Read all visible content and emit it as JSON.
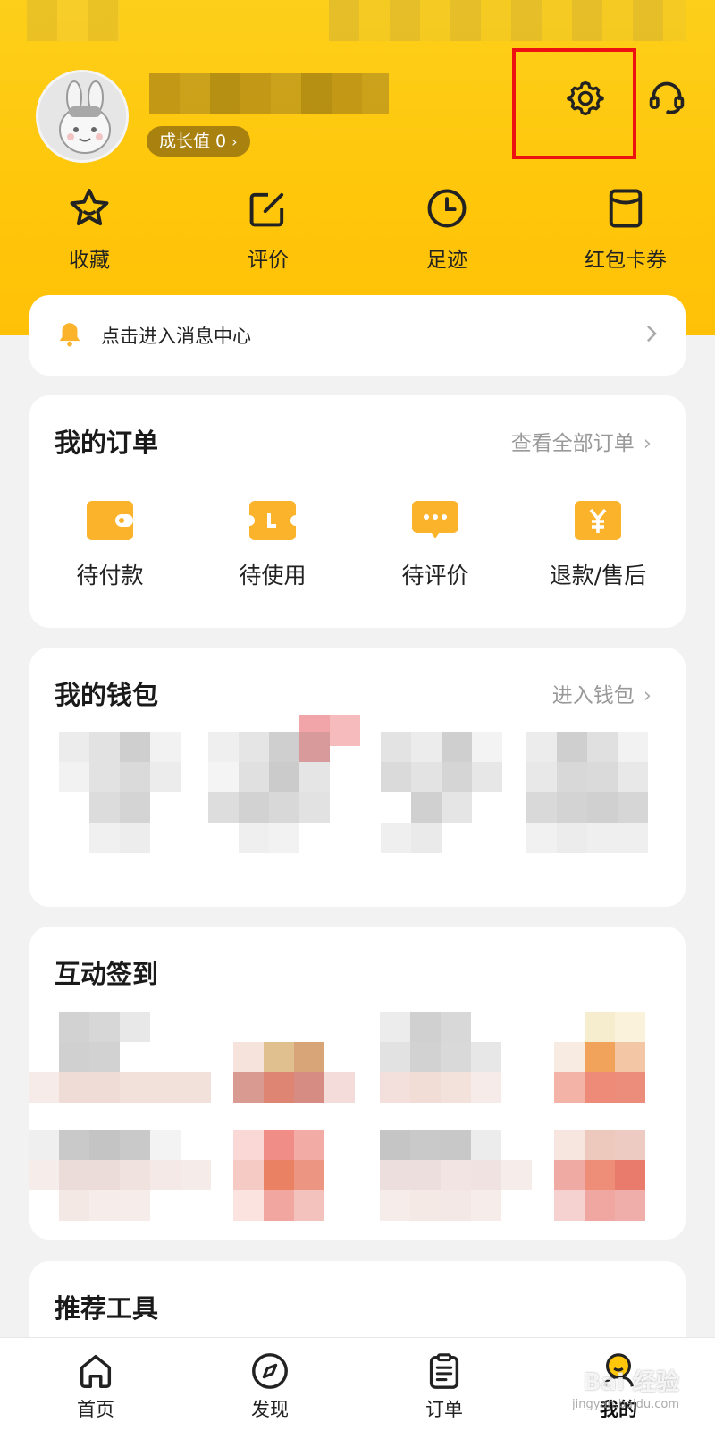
{
  "profile": {
    "growth_label": "成长值 0",
    "growth_chevron": "›"
  },
  "top_actions": {
    "settings_icon": "gear-icon",
    "service_icon": "headset-icon"
  },
  "quick_links": [
    {
      "label": "收藏",
      "icon": "star-icon"
    },
    {
      "label": "评价",
      "icon": "edit-icon"
    },
    {
      "label": "足迹",
      "icon": "clock-icon"
    },
    {
      "label": "红包卡券",
      "icon": "coupon-icon"
    }
  ],
  "message": {
    "text": "点击进入消息中心",
    "icon": "bell-icon"
  },
  "orders": {
    "title": "我的订单",
    "link": "查看全部订单",
    "items": [
      {
        "label": "待付款",
        "icon": "wallet-icon"
      },
      {
        "label": "待使用",
        "icon": "ticket-icon"
      },
      {
        "label": "待评价",
        "icon": "comment-icon"
      },
      {
        "label": "退款/售后",
        "icon": "refund-icon"
      }
    ]
  },
  "wallet": {
    "title": "我的钱包",
    "link": "进入钱包"
  },
  "checkin": {
    "title": "互动签到"
  },
  "tools": {
    "title": "推荐工具"
  },
  "tabbar": {
    "items": [
      {
        "label": "首页",
        "icon": "home-icon"
      },
      {
        "label": "发现",
        "icon": "compass-icon"
      },
      {
        "label": "订单",
        "icon": "order-list-icon"
      },
      {
        "label": "我的",
        "icon": "profile-icon",
        "active": true
      }
    ]
  },
  "watermark": {
    "text": "Bai 经验",
    "sub": "jingyan.baidu.com"
  },
  "colors": {
    "brand_yellow": "#ffc60a",
    "highlight_red": "#ee1111",
    "order_icon_orange": "#fbb32b"
  }
}
